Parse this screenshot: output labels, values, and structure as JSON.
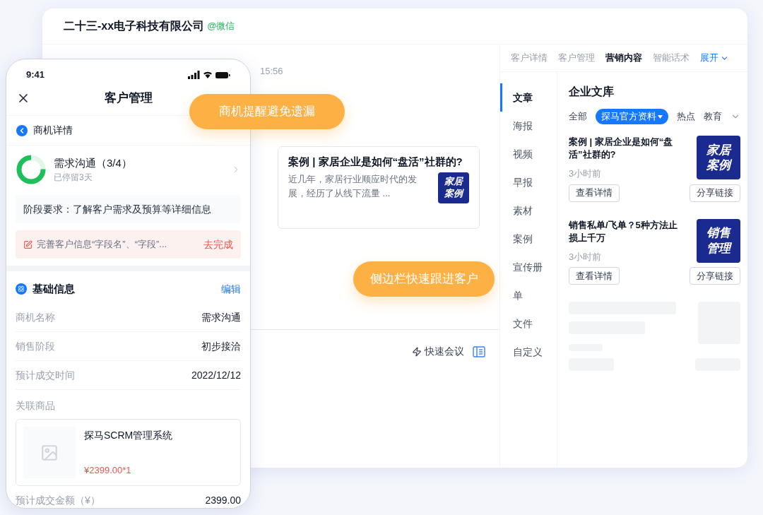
{
  "desktop": {
    "title": "二十三-xx电子科技有限公司",
    "source": "@微信",
    "chat": {
      "time": "15:56",
      "message": {
        "title": "案例 | 家居企业是如何“盘活”社群的?",
        "summary": "近几年，家居行业顺应时代的发展，经历了从线下流量 ...",
        "thumb_lines": [
          "家居",
          "案例"
        ]
      },
      "quick_meeting": "快速会议"
    },
    "panel": {
      "tabs": [
        {
          "label": "客户详情",
          "selected": false
        },
        {
          "label": "客户管理",
          "selected": false
        },
        {
          "label": "营销内容",
          "selected": true
        },
        {
          "label": "智能话术",
          "selected": false
        }
      ],
      "expand": "展开",
      "nav": [
        {
          "label": "文章",
          "selected": true
        },
        {
          "label": "海报",
          "selected": false
        },
        {
          "label": "视频",
          "selected": false
        },
        {
          "label": "早报",
          "selected": false
        },
        {
          "label": "素材",
          "selected": false
        },
        {
          "label": "案例",
          "selected": false
        },
        {
          "label": "宣传册",
          "selected": false
        },
        {
          "label": "单",
          "selected": false
        },
        {
          "label": "文件",
          "selected": false
        },
        {
          "label": "自定义",
          "selected": false
        }
      ],
      "library": {
        "title": "企业文库",
        "filters": [
          {
            "label": "全部",
            "selected": false
          },
          {
            "label": "探马官方资料",
            "selected": true
          },
          {
            "label": "热点",
            "selected": false
          },
          {
            "label": "教育",
            "selected": false
          }
        ],
        "articles": [
          {
            "title": "案例 | 家居企业是如何“盘活”社群的?",
            "time": "3小时前",
            "thumb_lines": [
              "家居",
              "案例"
            ],
            "view": "查看详情",
            "share": "分享链接"
          },
          {
            "title": "销售私单/飞单？5种方法止损上千万",
            "time": "3小时前",
            "thumb_lines": [
              "销售",
              "管理"
            ],
            "view": "查看详情",
            "share": "分享链接"
          }
        ]
      }
    }
  },
  "phone": {
    "status_time": "9:41",
    "title": "客户管理",
    "back": "商机详情",
    "stage": {
      "name": "需求沟通（3/4）",
      "stay": "已停留3天",
      "level": 0.75
    },
    "requirement": "阶段要求：了解客户需求及预算等详细信息",
    "task": {
      "text": "完善客户信息“字段名”、“字段”...",
      "action": "去完成"
    },
    "basic": {
      "title": "基础信息",
      "edit": "编辑",
      "rows": [
        {
          "label": "商机名称",
          "value": "需求沟通"
        },
        {
          "label": "销售阶段",
          "value": "初步接洽"
        },
        {
          "label": "预计成交时间",
          "value": "2022/12/12"
        }
      ]
    },
    "product_label": "关联商品",
    "product": {
      "name": "探马SCRM管理系统",
      "price": "¥2399.00*1"
    },
    "amount": {
      "label": "预计成交金额（¥）",
      "value": "2399.00"
    }
  },
  "callouts": [
    "商机提醒避免遗漏",
    "侧边栏快速跟进客户"
  ]
}
